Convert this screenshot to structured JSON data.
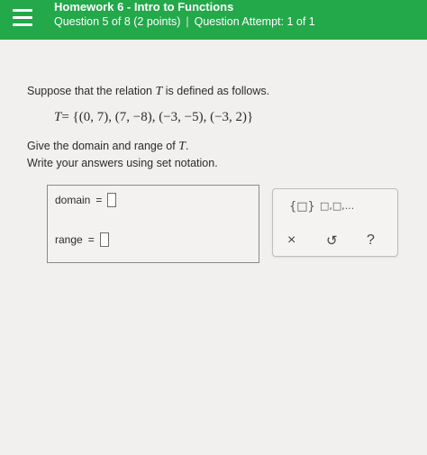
{
  "header": {
    "title": "Homework 6 - Intro to Functions",
    "question": "Question 5 of 8 (2 points)",
    "attempt": "Question Attempt: 1 of 1"
  },
  "problem": {
    "prompt_before": "Suppose that the relation ",
    "relation_var": "T",
    "prompt_after": " is defined as follows.",
    "relation_lhs": "T",
    "relation_rhs": "= {(0, 7), (7, −8), (−3, −5), (−3, 2)}",
    "give_before": "Give the domain and range of ",
    "give_after": ".",
    "instruction": "Write your answers using set notation."
  },
  "answers": {
    "domain_label": "domain",
    "range_label": "range",
    "equals": "="
  },
  "tools": {
    "set_brackets_icon": "{□}",
    "list_icon": "□,□,...",
    "clear_icon": "×",
    "undo_icon": "↺",
    "help_icon": "?"
  }
}
